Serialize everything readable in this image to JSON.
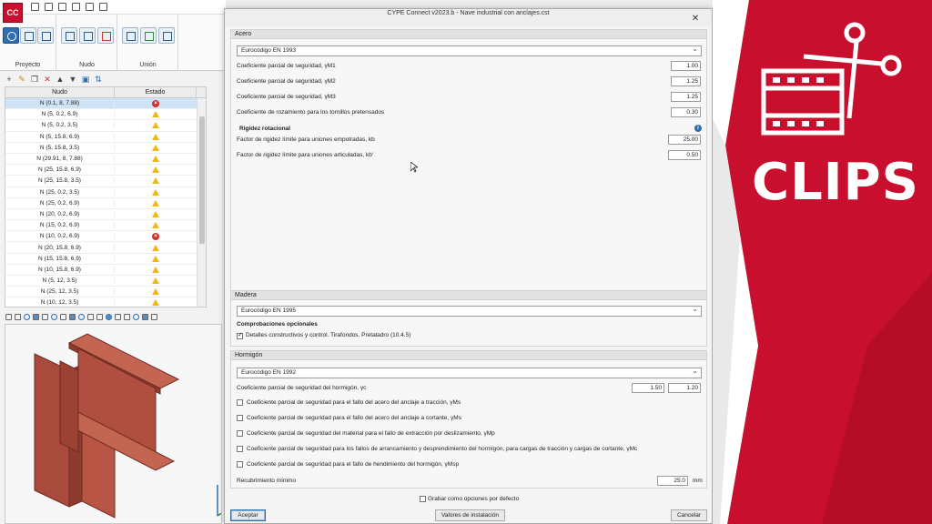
{
  "app": {
    "logo_text": "CC",
    "ribbon": {
      "groups": [
        {
          "label": "Proyecto"
        },
        {
          "label": "Nudo"
        },
        {
          "label": "Unión"
        }
      ]
    },
    "tree": {
      "headers": {
        "node": "Nudo",
        "state": "Estado"
      },
      "rows": [
        {
          "node": "N (0.1, 8, 7.88)",
          "state": "error",
          "selected": true
        },
        {
          "node": "N (5, 0.2, 6.9)",
          "state": "warning"
        },
        {
          "node": "N (5, 0.2, 3.5)",
          "state": "warning"
        },
        {
          "node": "N (5, 15.8, 6.9)",
          "state": "warning"
        },
        {
          "node": "N (5, 15.8, 3.5)",
          "state": "warning"
        },
        {
          "node": "N (29.91, 8, 7.88)",
          "state": "warning"
        },
        {
          "node": "N (25, 15.8, 6.9)",
          "state": "warning"
        },
        {
          "node": "N (25, 15.8, 3.5)",
          "state": "warning"
        },
        {
          "node": "N (25, 0.2, 3.5)",
          "state": "warning"
        },
        {
          "node": "N (25, 0.2, 6.9)",
          "state": "warning"
        },
        {
          "node": "N (20, 0.2, 6.9)",
          "state": "warning"
        },
        {
          "node": "N (15, 0.2, 6.9)",
          "state": "warning"
        },
        {
          "node": "N (10, 0.2, 6.9)",
          "state": "error"
        },
        {
          "node": "N (20, 15.8, 6.9)",
          "state": "warning"
        },
        {
          "node": "N (15, 15.8, 6.9)",
          "state": "warning"
        },
        {
          "node": "N (10, 15.8, 6.9)",
          "state": "warning"
        },
        {
          "node": "N (5, 12, 3.5)",
          "state": "warning"
        },
        {
          "node": "N (25, 12, 3.5)",
          "state": "warning"
        },
        {
          "node": "N (10, 12, 3.5)",
          "state": "warning"
        }
      ]
    }
  },
  "dialog": {
    "title": "CYPE Connect v2023.b - Nave industrial con anclajes.cst",
    "acero": {
      "title": "Acero",
      "code": "Eurocódigo EN 1993",
      "rows": [
        {
          "label": "Coeficiente parcial de seguridad, γM1",
          "value": "1.00"
        },
        {
          "label": "Coeficiente parcial de seguridad, γM2",
          "value": "1.25"
        },
        {
          "label": "Coeficiente parcial de seguridad, γM3",
          "value": "1.25"
        },
        {
          "label": "Coeficiente de rozamiento para los tornillos pretensados",
          "value": "0.30"
        }
      ],
      "rigidity_title": "Rigidez rotacional",
      "rigidity_rows": [
        {
          "label": "Factor de rigidez límite para uniones empotradas, kb",
          "value": "25.00"
        },
        {
          "label": "Factor de rigidez límite para uniones articuladas, kb'",
          "value": "0.50"
        }
      ]
    },
    "madera": {
      "title": "Madera",
      "code": "Eurocódigo EN 1995",
      "optional_title": "Comprobaciones opcionales",
      "check_label": "Detalles constructivos y control. Tirafondos. Pretaladro (10.4.5)"
    },
    "hormigon": {
      "title": "Hormigón",
      "code": "Eurocódigo EN 1992",
      "concrete_label": "Coeficiente parcial de seguridad del hormigón, γc",
      "concrete_values": [
        "1.50",
        "1.20"
      ],
      "checks": [
        "Coeficiente parcial de seguridad para el fallo del acero del anclaje a tracción, γMs",
        "Coeficiente parcial de seguridad para el fallo del acero del anclaje a cortante, γMs",
        "Coeficiente parcial de seguridad del material para el fallo de extracción por deslizamiento, γMp",
        "Coeficiente parcial de seguridad para los fallos de arrancamiento y desprendimiento del hormigón, para cargas de tracción y cargas de cortante, γMc",
        "Coeficiente parcial de seguridad para el fallo de hendimiento del hormigón, γMsp"
      ],
      "cover_label": "Recubrimiento mínimo",
      "cover_value": "25.0",
      "cover_unit": "mm"
    },
    "save_default_label": "Grabar como opciones por defecto",
    "buttons": {
      "accept": "Aceptar",
      "install_values": "Valores de instalación",
      "cancel": "Cancelar"
    }
  },
  "promo": {
    "text": "CLIPS",
    "colors": {
      "red": "#c8102e",
      "dark_red": "#9e0b23",
      "white": "#ffffff"
    }
  }
}
